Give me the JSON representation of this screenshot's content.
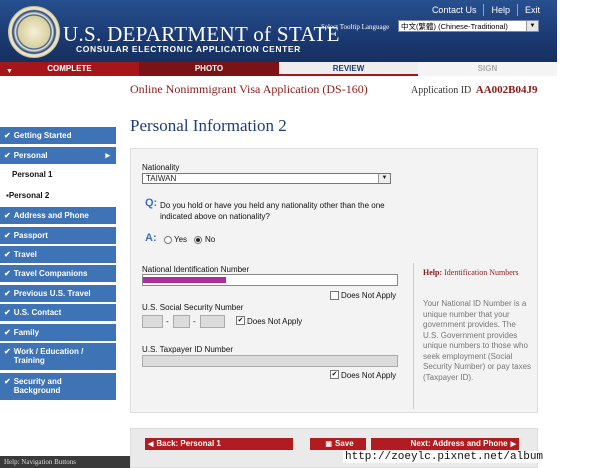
{
  "header": {
    "title": "U.S. DEPARTMENT of STATE",
    "subtitle": "CONSULAR ELECTRONIC APPLICATION CENTER",
    "links": [
      "Contact Us",
      "Help",
      "Exit"
    ],
    "language_label": "Select Tooltip Language",
    "language_value": "中文(繁體) (Chinese-Traditional)"
  },
  "steps": [
    "COMPLETE",
    "PHOTO",
    "REVIEW",
    "SIGN"
  ],
  "app": {
    "title": "Online Nonimmigrant Visa Application (DS-160)",
    "id_label": "Application ID",
    "id_value": "AA002B04J9"
  },
  "page_title": "Personal Information 2",
  "sidebar": {
    "items": [
      {
        "label": "Getting Started",
        "type": "section"
      },
      {
        "label": "Personal",
        "type": "section"
      },
      {
        "label": "Personal 1",
        "type": "sub"
      },
      {
        "label": "Personal 2",
        "type": "sub-current"
      },
      {
        "label": "Address and Phone",
        "type": "section"
      },
      {
        "label": "Passport",
        "type": "section"
      },
      {
        "label": "Travel",
        "type": "section"
      },
      {
        "label": "Travel Companions",
        "type": "section"
      },
      {
        "label": "Previous U.S. Travel",
        "type": "section"
      },
      {
        "label": "U.S. Contact",
        "type": "section"
      },
      {
        "label": "Family",
        "type": "section"
      },
      {
        "label": "Work / Education / Training",
        "type": "section"
      },
      {
        "label": "Security and Background",
        "type": "section"
      }
    ]
  },
  "form": {
    "nationality_label": "Nationality",
    "nationality_value": "TAIWAN",
    "q_letter": "Q:",
    "question": "Do you hold or have you held any nationality other than the one indicated above on nationality?",
    "a_letter": "A:",
    "answer_yes": "Yes",
    "answer_no": "No",
    "answer_selected": "No",
    "national_id_label": "National Identification Number",
    "does_not_apply": "Does Not Apply",
    "ssn_label": "U.S. Social Security Number",
    "ssn_dash": "-",
    "ssn_does_not_apply_checked": true,
    "taxpayer_label": "U.S. Taxpayer ID Number",
    "taxpayer_does_not_apply_checked": true
  },
  "help": {
    "prefix": "Help:",
    "title": "Identification Numbers",
    "text": "Your National ID Number is a unique number that your government provides. The U.S. Government provides unique numbers to those who seek employment (Social Security Number) or pay taxes (Taxpayer ID)."
  },
  "buttons": {
    "back": "Back: Personal 1",
    "save": "Save",
    "next": "Next: Address and Phone"
  },
  "footer": "Help: Navigation Buttons",
  "watermark": "http://zoeylc.pixnet.net/album",
  "colors": {
    "header_blue": "#1d3e7a",
    "nav_blue": "#3e73b6",
    "brand_red": "#a4161a"
  }
}
